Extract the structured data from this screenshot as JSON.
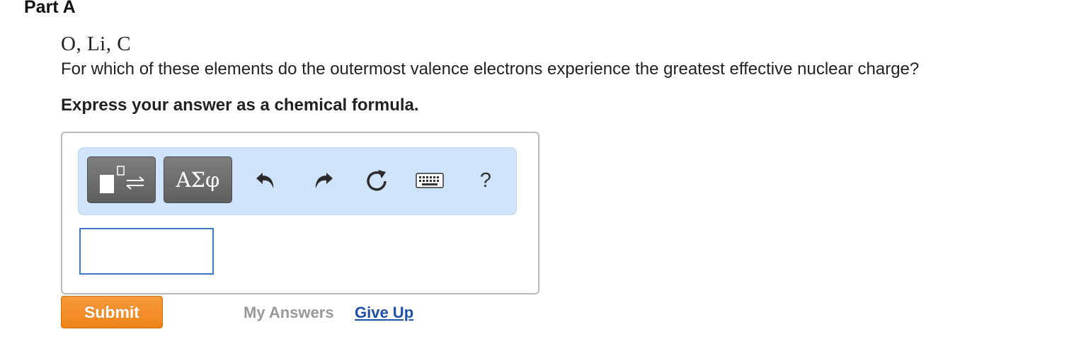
{
  "part": {
    "title": "Part A"
  },
  "problem": {
    "elements": "O, Li, C",
    "question": "For which of these elements do the outermost valence electrons experience the greatest effective nuclear charge?",
    "instruction": "Express your answer as a chemical formula."
  },
  "toolbar": {
    "templates_icon": "templates-icon",
    "symbols_label": "ΑΣφ",
    "undo_icon": "undo-icon",
    "redo_icon": "redo-icon",
    "reset_icon": "reset-icon",
    "keyboard_icon": "keyboard-icon",
    "help_label": "?"
  },
  "answer": {
    "value": ""
  },
  "actions": {
    "submit_label": "Submit",
    "my_answers_label": "My Answers",
    "give_up_label": "Give Up"
  },
  "colors": {
    "toolbar_bg": "#cfe4fb",
    "submit_orange": "#f08c22",
    "link_blue": "#1f4fa8",
    "input_border": "#3c78c3"
  }
}
